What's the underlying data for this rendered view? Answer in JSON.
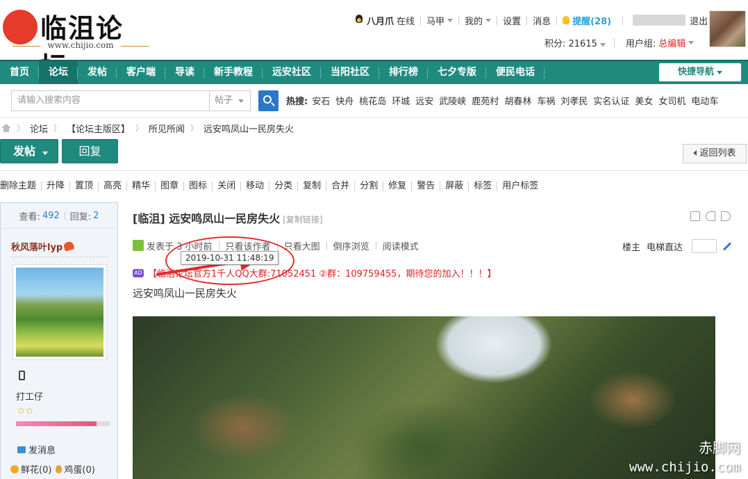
{
  "logo": {
    "title": "临沮论坛",
    "domain": "www.chijio.com"
  },
  "user_bar": {
    "username": "八月爪",
    "online": "在线",
    "vest": "马甲",
    "mine": "我的",
    "settings": "设置",
    "messages": "消息",
    "remind": "提醒(28)",
    "logout": "退出",
    "points": "积分: 21615",
    "usergroup_label": "用户组:",
    "usergroup_value": "总编辑"
  },
  "nav": {
    "items": [
      "首页",
      "论坛",
      "发帖",
      "客户端",
      "导读",
      "新手教程",
      "远安社区",
      "当阳社区",
      "排行榜",
      "七夕专版",
      "便民电话"
    ],
    "active_index": 1,
    "quick_nav": "快捷导航"
  },
  "search": {
    "placeholder": "请输入搜索内容",
    "type": "帖子",
    "hot_label": "热搜:",
    "hot_items": [
      "安石",
      "快舟",
      "桃花岛",
      "环城",
      "远安",
      "武陵峡",
      "鹿苑村",
      "胡春林",
      "车祸",
      "刘孝民",
      "实名认证",
      "美女",
      "女司机",
      "电动车"
    ]
  },
  "breadcrumb": [
    "论坛",
    "【论坛主版区】",
    "所见所闻",
    "远安鸣凤山一民房失火"
  ],
  "actions": {
    "post": "发帖",
    "reply": "回复",
    "back": "返回列表"
  },
  "moderation": [
    "删除主题",
    "升降",
    "置顶",
    "高亮",
    "精华",
    "图章",
    "图标",
    "关闭",
    "移动",
    "分类",
    "复制",
    "合并",
    "分割",
    "修复",
    "警告",
    "屏蔽",
    "标签",
    "用户标签"
  ],
  "sidebar": {
    "views_label": "查看:",
    "views": "492",
    "replies_label": "回复:",
    "replies": "2",
    "author_name": "秋风落叶lyp",
    "rank": "打工仔",
    "stars": "✩✩",
    "level_fraction": 0.86,
    "send_message": "发消息",
    "flowers": "鲜花(0)",
    "eggs": "鸡蛋(0)"
  },
  "post": {
    "title": "[临沮] 远安鸣凤山一民房失火",
    "copy_link": "[复制链接]",
    "posted": "发表于 3 小时前",
    "only_author": "只看该作者",
    "only_big_image": "只看大图",
    "reverse": "倒序浏览",
    "read_mode": "阅读模式",
    "floor": "楼主",
    "jump_floor": "电梯直达",
    "tooltip_time": "2019-10-31 11:48:19",
    "notice": "【临沮论坛官方1千人QQ大群:71052451 ②群：109759455，期待您的加入！！！】",
    "ad_label": "AD",
    "body": "远安鸣凤山一民房失火"
  },
  "watermark": {
    "line1": "赤脚网",
    "line2": "www.chijio.com"
  },
  "colors": {
    "nav_bg": "#1f8b7f",
    "remind": "#2aa1d8",
    "usergroup": "#e02020",
    "annotation": "#e42a2a"
  }
}
